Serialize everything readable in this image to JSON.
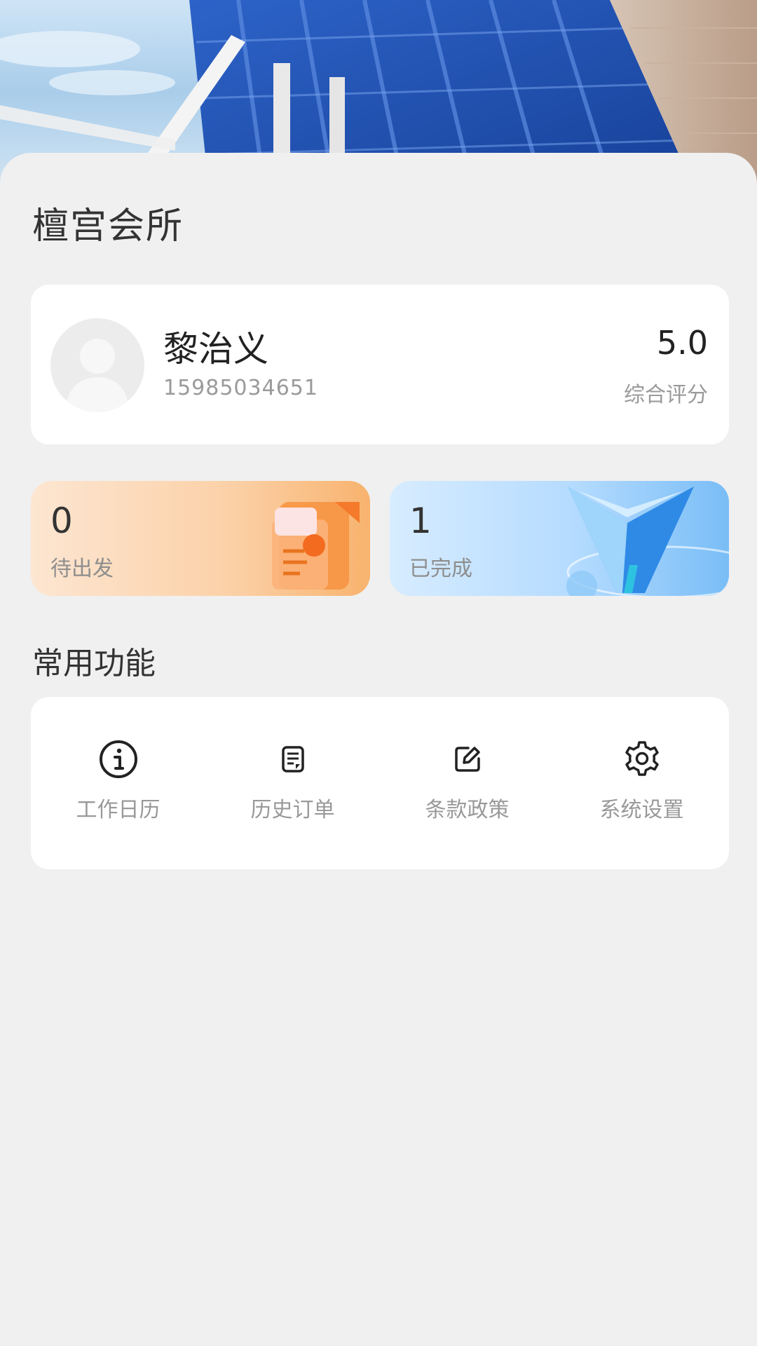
{
  "header": {
    "club_name": "檀宫会所"
  },
  "profile": {
    "name": "黎治义",
    "phone": "15985034651",
    "rating_value": "5.0",
    "rating_label": "综合评分"
  },
  "stats": [
    {
      "value": "0",
      "label": "待出发"
    },
    {
      "value": "1",
      "label": "已完成"
    }
  ],
  "functions": {
    "title": "常用功能",
    "items": [
      {
        "label": "工作日历",
        "icon": "info-circle-icon"
      },
      {
        "label": "历史订单",
        "icon": "document-icon"
      },
      {
        "label": "条款政策",
        "icon": "edit-icon"
      },
      {
        "label": "系统设置",
        "icon": "gear-icon"
      }
    ]
  },
  "colors": {
    "background": "#f0f0f0",
    "card": "#ffffff",
    "pending_gradient_end": "#f8b36e",
    "done_gradient_end": "#79bdf6"
  }
}
